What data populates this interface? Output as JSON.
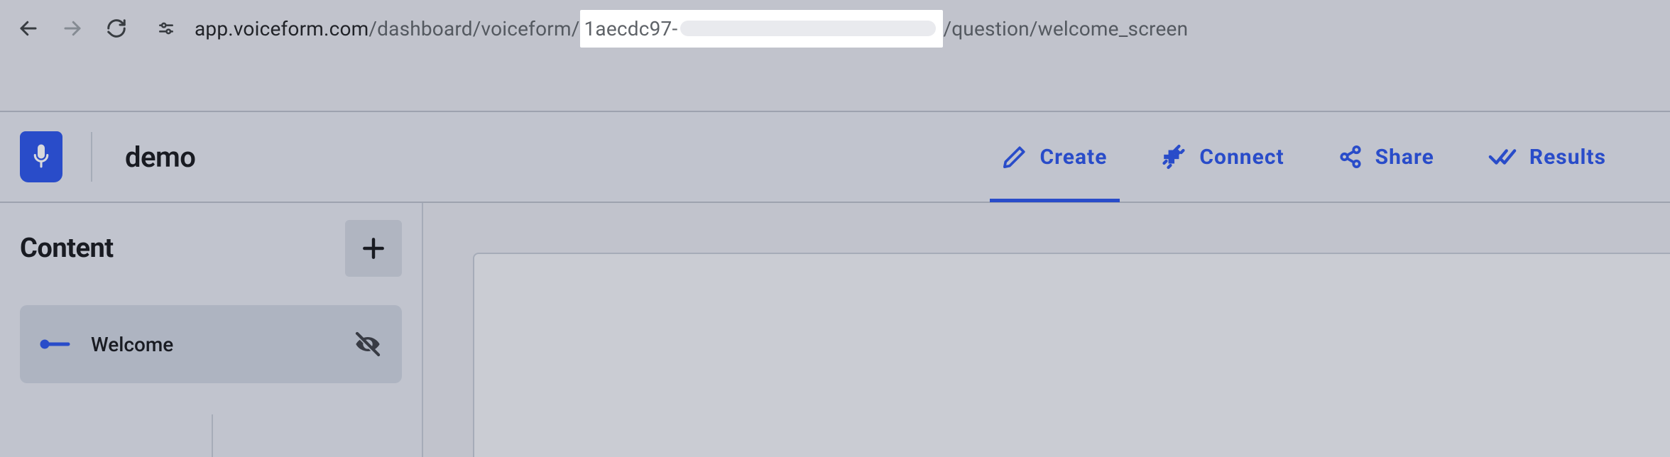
{
  "browser": {
    "url_host": "app.voiceform.com",
    "url_path_before": "/dashboard/voiceform/",
    "url_id_visible": "1aecdc97-",
    "url_path_after": "/question/welcome_screen"
  },
  "header": {
    "form_name": "demo",
    "tabs": [
      {
        "key": "create",
        "label": "Create",
        "icon": "pencil-icon",
        "active": true
      },
      {
        "key": "connect",
        "label": "Connect",
        "icon": "plug-icon",
        "active": false
      },
      {
        "key": "share",
        "label": "Share",
        "icon": "share-icon",
        "active": false
      },
      {
        "key": "results",
        "label": "Results",
        "icon": "check-icon",
        "active": false
      }
    ]
  },
  "sidebar": {
    "title": "Content",
    "items": [
      {
        "label": "Welcome",
        "icon": "start-line-icon",
        "hidden": true
      }
    ]
  },
  "colors": {
    "accent": "#2a53e8"
  }
}
